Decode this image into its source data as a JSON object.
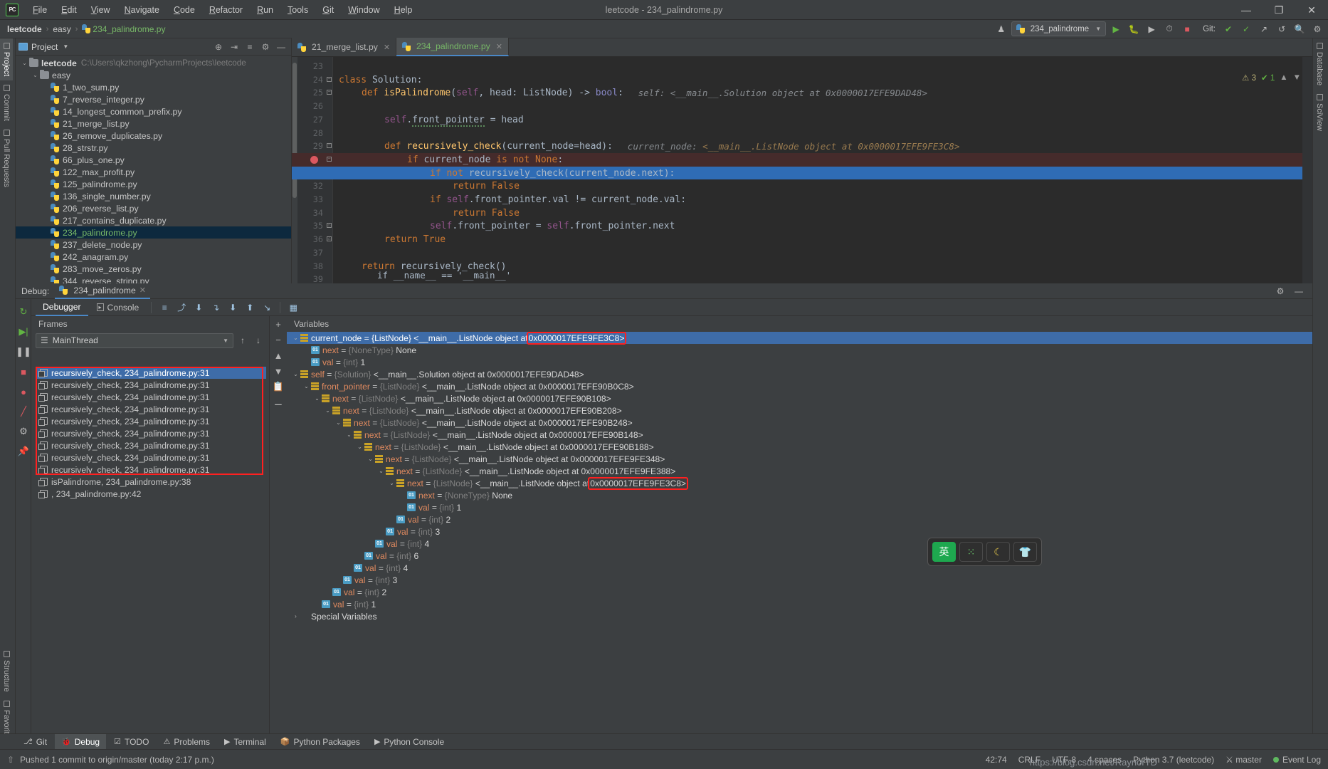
{
  "titlebar": {
    "logo": "PC",
    "menus": [
      "File",
      "Edit",
      "View",
      "Navigate",
      "Code",
      "Refactor",
      "Run",
      "Tools",
      "Git",
      "Window",
      "Help"
    ],
    "title": "leetcode - 234_palindrome.py",
    "minimize": "—",
    "maximize": "❐",
    "close": "✕"
  },
  "navbar": {
    "breadcrumbs": [
      "leetcode",
      "easy",
      "234_palindrome.py"
    ],
    "separator": "›",
    "run_config": "234_palindrome",
    "git_label": "Git:",
    "buttons": [
      "▶",
      "🐞",
      "↻",
      "⏱",
      "■"
    ],
    "right_icons": [
      "✔",
      "✓",
      "↗",
      "↺",
      "🔍",
      "⚙"
    ]
  },
  "left_strip": {
    "tabs": [
      "Project",
      "Commit",
      "Pull Requests"
    ],
    "bottom_tabs": [
      "Structure",
      "Favorites"
    ]
  },
  "right_strip": {
    "tabs": [
      "Database",
      "SciView"
    ]
  },
  "project_panel": {
    "title": "Project",
    "actions": [
      "⊕",
      "⇥",
      "≡",
      "⚙",
      "—"
    ],
    "tree": [
      {
        "depth": 0,
        "type": "folder",
        "label": "leetcode",
        "path": "C:\\Users\\qkzhong\\PycharmProjects\\leetcode",
        "expanded": true,
        "bold": true
      },
      {
        "depth": 1,
        "type": "folder",
        "label": "easy",
        "path": "",
        "expanded": true,
        "bold": false
      },
      {
        "depth": 2,
        "type": "py",
        "label": "1_two_sum.py"
      },
      {
        "depth": 2,
        "type": "py",
        "label": "7_reverse_integer.py"
      },
      {
        "depth": 2,
        "type": "py",
        "label": "14_longest_common_prefix.py"
      },
      {
        "depth": 2,
        "type": "py",
        "label": "21_merge_list.py"
      },
      {
        "depth": 2,
        "type": "py",
        "label": "26_remove_duplicates.py"
      },
      {
        "depth": 2,
        "type": "py",
        "label": "28_strstr.py"
      },
      {
        "depth": 2,
        "type": "py",
        "label": "66_plus_one.py"
      },
      {
        "depth": 2,
        "type": "py",
        "label": "122_max_profit.py"
      },
      {
        "depth": 2,
        "type": "py",
        "label": "125_palindrome.py"
      },
      {
        "depth": 2,
        "type": "py",
        "label": "136_single_number.py"
      },
      {
        "depth": 2,
        "type": "py",
        "label": "206_reverse_list.py"
      },
      {
        "depth": 2,
        "type": "py",
        "label": "217_contains_duplicate.py"
      },
      {
        "depth": 2,
        "type": "py",
        "label": "234_palindrome.py",
        "selected": true
      },
      {
        "depth": 2,
        "type": "py",
        "label": "237_delete_node.py"
      },
      {
        "depth": 2,
        "type": "py",
        "label": "242_anagram.py"
      },
      {
        "depth": 2,
        "type": "py",
        "label": "283_move_zeros.py"
      },
      {
        "depth": 2,
        "type": "py",
        "label": "344_reverse_string.py"
      }
    ]
  },
  "editor": {
    "tabs": [
      {
        "label": "21_merge_list.py",
        "active": false
      },
      {
        "label": "234_palindrome.py",
        "active": true
      }
    ],
    "inspection": {
      "warnings": "3",
      "ok": "1"
    },
    "first_line_number": 23,
    "lines": [
      {
        "num": 23,
        "text": "",
        "state": "normal"
      },
      {
        "num": 24,
        "text": "class Solution:",
        "state": "normal"
      },
      {
        "num": 25,
        "text": "def isPalindrome(self, head: ListNode) -> bool:",
        "hint": "self: <__main__.Solution object at 0x0000017EFE9DAD48>",
        "state": "normal"
      },
      {
        "num": 26,
        "text": "",
        "state": "normal"
      },
      {
        "num": 27,
        "text": "self.front_pointer = head",
        "state": "normal"
      },
      {
        "num": 28,
        "text": "",
        "state": "normal"
      },
      {
        "num": 29,
        "text": "def recursively_check(current_node=head):",
        "hint": "current_node: <__main__.ListNode object at 0x0000017EFE9FE3C8>",
        "state": "normal"
      },
      {
        "num": 30,
        "text": "if current_node is not None:",
        "state": "breakpoint"
      },
      {
        "num": 31,
        "text": "if not recursively_check(current_node.next):",
        "state": "current"
      },
      {
        "num": 32,
        "text": "return False",
        "state": "normal"
      },
      {
        "num": 33,
        "text": "if self.front_pointer.val != current_node.val:",
        "state": "normal"
      },
      {
        "num": 34,
        "text": "return False",
        "state": "normal"
      },
      {
        "num": 35,
        "text": "self.front_pointer = self.front_pointer.next",
        "state": "normal"
      },
      {
        "num": 36,
        "text": "return True",
        "state": "normal"
      },
      {
        "num": 37,
        "text": "",
        "state": "normal"
      },
      {
        "num": 38,
        "text": "return recursively_check()",
        "state": "normal"
      },
      {
        "num": 39,
        "text": "",
        "state": "normal"
      }
    ],
    "below_line": "if __name__ == '__main__'"
  },
  "debug": {
    "label": "Debug:",
    "session": "234_palindrome",
    "tabs": [
      {
        "label": "Debugger",
        "active": true
      },
      {
        "label": "Console",
        "active": false
      }
    ],
    "toolbar_icons": [
      "≡",
      "⤴",
      "⬇",
      "↴",
      "⬇",
      "⬆",
      "↘"
    ],
    "frames_label": "Frames",
    "thread": "MainThread",
    "frames": [
      {
        "label": "recursively_check, 234_palindrome.py:31",
        "selected": true,
        "boxed": true
      },
      {
        "label": "recursively_check, 234_palindrome.py:31",
        "selected": false,
        "boxed": true
      },
      {
        "label": "recursively_check, 234_palindrome.py:31",
        "selected": false,
        "boxed": true
      },
      {
        "label": "recursively_check, 234_palindrome.py:31",
        "selected": false,
        "boxed": true
      },
      {
        "label": "recursively_check, 234_palindrome.py:31",
        "selected": false,
        "boxed": true
      },
      {
        "label": "recursively_check, 234_palindrome.py:31",
        "selected": false,
        "boxed": true
      },
      {
        "label": "recursively_check, 234_palindrome.py:31",
        "selected": false,
        "boxed": true
      },
      {
        "label": "recursively_check, 234_palindrome.py:31",
        "selected": false,
        "boxed": true
      },
      {
        "label": "recursively_check, 234_palindrome.py:31",
        "selected": false,
        "boxed": true
      },
      {
        "label": "isPalindrome, 234_palindrome.py:38",
        "selected": false,
        "boxed": false
      },
      {
        "label": "<module>, 234_palindrome.py:42",
        "selected": false,
        "boxed": false
      }
    ],
    "variables_label": "Variables",
    "variables": [
      {
        "depth": 0,
        "twisty": "v",
        "kind": "obj",
        "name": "current_node",
        "type": "{ListNode}",
        "value": "<__main__.ListNode object at ",
        "addr": "0x0000017EFE9FE3C8>",
        "selected": true,
        "highlight_addr": true
      },
      {
        "depth": 1,
        "twisty": "",
        "kind": "prim",
        "name": "next",
        "type": "{NoneType}",
        "value": "None",
        "addr": "",
        "selected": false
      },
      {
        "depth": 1,
        "twisty": "",
        "kind": "prim",
        "name": "val",
        "type": "{int}",
        "value": "1",
        "addr": "",
        "selected": false
      },
      {
        "depth": 0,
        "twisty": "v",
        "kind": "obj",
        "name": "self",
        "type": "{Solution}",
        "value": "<__main__.Solution object at 0x0000017EFE9DAD48>",
        "addr": "",
        "selected": false
      },
      {
        "depth": 1,
        "twisty": "v",
        "kind": "obj",
        "name": "front_pointer",
        "type": "{ListNode}",
        "value": "<__main__.ListNode object at 0x0000017EFE90B0C8>",
        "addr": "",
        "selected": false
      },
      {
        "depth": 2,
        "twisty": "v",
        "kind": "obj",
        "name": "next",
        "type": "{ListNode}",
        "value": "<__main__.ListNode object at 0x0000017EFE90B108>",
        "addr": "",
        "selected": false
      },
      {
        "depth": 3,
        "twisty": "v",
        "kind": "obj",
        "name": "next",
        "type": "{ListNode}",
        "value": "<__main__.ListNode object at 0x0000017EFE90B208>",
        "addr": "",
        "selected": false
      },
      {
        "depth": 4,
        "twisty": "v",
        "kind": "obj",
        "name": "next",
        "type": "{ListNode}",
        "value": "<__main__.ListNode object at 0x0000017EFE90B248>",
        "addr": "",
        "selected": false
      },
      {
        "depth": 5,
        "twisty": "v",
        "kind": "obj",
        "name": "next",
        "type": "{ListNode}",
        "value": "<__main__.ListNode object at 0x0000017EFE90B148>",
        "addr": "",
        "selected": false
      },
      {
        "depth": 6,
        "twisty": "v",
        "kind": "obj",
        "name": "next",
        "type": "{ListNode}",
        "value": "<__main__.ListNode object at 0x0000017EFE90B188>",
        "addr": "",
        "selected": false
      },
      {
        "depth": 7,
        "twisty": "v",
        "kind": "obj",
        "name": "next",
        "type": "{ListNode}",
        "value": "<__main__.ListNode object at 0x0000017EFE9FE348>",
        "addr": "",
        "selected": false
      },
      {
        "depth": 8,
        "twisty": "v",
        "kind": "obj",
        "name": "next",
        "type": "{ListNode}",
        "value": "<__main__.ListNode object at 0x0000017EFE9FE388>",
        "addr": "",
        "selected": false
      },
      {
        "depth": 9,
        "twisty": "v",
        "kind": "obj",
        "name": "next",
        "type": "{ListNode}",
        "value": "<__main__.ListNode object at ",
        "addr": "0x0000017EFE9FE3C8>",
        "selected": false,
        "highlight_addr": true
      },
      {
        "depth": 10,
        "twisty": "",
        "kind": "prim",
        "name": "next",
        "type": "{NoneType}",
        "value": "None",
        "addr": "",
        "selected": false
      },
      {
        "depth": 10,
        "twisty": "",
        "kind": "prim",
        "name": "val",
        "type": "{int}",
        "value": "1",
        "addr": "",
        "selected": false
      },
      {
        "depth": 9,
        "twisty": "",
        "kind": "prim",
        "name": "val",
        "type": "{int}",
        "value": "2",
        "addr": "",
        "selected": false
      },
      {
        "depth": 8,
        "twisty": "",
        "kind": "prim",
        "name": "val",
        "type": "{int}",
        "value": "3",
        "addr": "",
        "selected": false
      },
      {
        "depth": 7,
        "twisty": "",
        "kind": "prim",
        "name": "val",
        "type": "{int}",
        "value": "4",
        "addr": "",
        "selected": false
      },
      {
        "depth": 6,
        "twisty": "",
        "kind": "prim",
        "name": "val",
        "type": "{int}",
        "value": "6",
        "addr": "",
        "selected": false
      },
      {
        "depth": 5,
        "twisty": "",
        "kind": "prim",
        "name": "val",
        "type": "{int}",
        "value": "4",
        "addr": "",
        "selected": false
      },
      {
        "depth": 4,
        "twisty": "",
        "kind": "prim",
        "name": "val",
        "type": "{int}",
        "value": "3",
        "addr": "",
        "selected": false
      },
      {
        "depth": 3,
        "twisty": "",
        "kind": "prim",
        "name": "val",
        "type": "{int}",
        "value": "2",
        "addr": "",
        "selected": false
      },
      {
        "depth": 2,
        "twisty": "",
        "kind": "prim",
        "name": "val",
        "type": "{int}",
        "value": "1",
        "addr": "",
        "selected": false
      },
      {
        "depth": 0,
        "twisty": ">",
        "kind": "special",
        "name": "Special Variables",
        "type": "",
        "value": "",
        "addr": "",
        "selected": false
      }
    ]
  },
  "ime": {
    "keys": [
      "英",
      "⁙",
      "☾",
      "👕"
    ]
  },
  "bottom_tools": [
    {
      "icon": "⎇",
      "label": "Git",
      "active": false
    },
    {
      "icon": "🐞",
      "label": "Debug",
      "active": true
    },
    {
      "icon": "☑",
      "label": "TODO",
      "active": false
    },
    {
      "icon": "⚠",
      "label": "Problems",
      "active": false
    },
    {
      "icon": "▶",
      "label": "Terminal",
      "active": false
    },
    {
      "icon": "📦",
      "label": "Python Packages",
      "active": false
    },
    {
      "icon": "▶",
      "label": "Python Console",
      "active": false
    }
  ],
  "statusbar": {
    "message": "Pushed 1 commit to origin/master (today 2:17 p.m.)",
    "watermark": "https://blog.csdn.net/RaynorTD",
    "position": "42:74",
    "line_sep": "CRLF",
    "encoding": "UTF-8",
    "indent": "4 spaces",
    "interpreter": "Python 3.7 (leetcode)",
    "branch": "master",
    "event_log": "Event Log"
  }
}
